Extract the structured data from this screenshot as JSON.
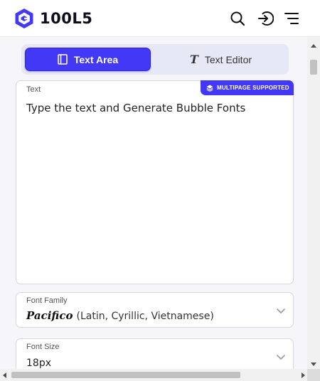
{
  "brand": {
    "name": "100L5",
    "color": "#4338f5"
  },
  "header": {
    "icons": [
      "search-icon",
      "login-icon",
      "menu-icon"
    ]
  },
  "tabs": [
    {
      "label": "Text Area",
      "icon": "notebook-icon",
      "active": true
    },
    {
      "label": "Text Editor",
      "icon": "italic-t-icon",
      "active": false
    }
  ],
  "text_area": {
    "label": "Text",
    "value": "Type the text and Generate Bubble Fonts",
    "badge": "MULTIPAGE SUPPORTED",
    "badge_icon": "layers-icon"
  },
  "font_family": {
    "label": "Font Family",
    "value_font": "Pacifico",
    "value_detail": "(Latin, Cyrillic, Vietnamese)"
  },
  "font_size": {
    "label": "Font Size",
    "value": "18px"
  },
  "colors": {
    "accent": "#4338f5",
    "tab_bg": "#e6e8f6",
    "page_bg": "#f6f6fa"
  }
}
